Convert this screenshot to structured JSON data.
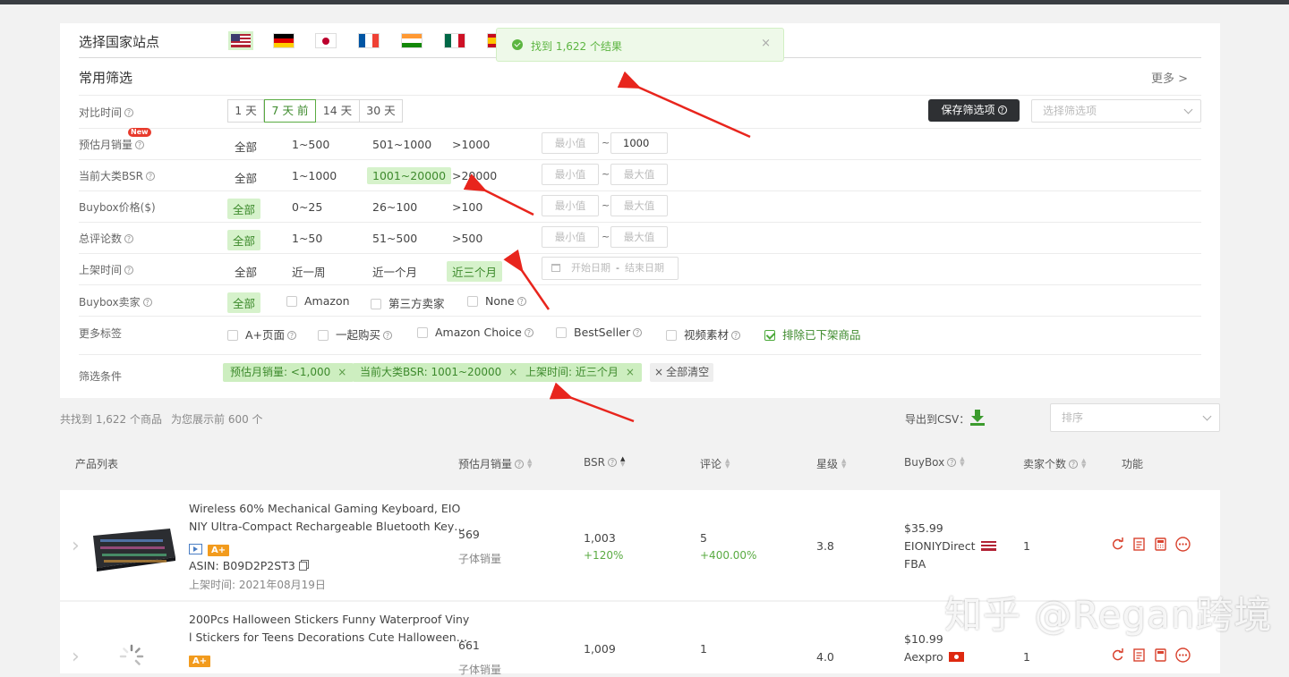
{
  "country": {
    "label": "选择国家站点",
    "flags": [
      "us-flag-icon",
      "de-flag-icon",
      "jp-flag-icon",
      "fr-flag-icon",
      "in-flag-icon",
      "mx-flag-icon",
      "es-flag-icon"
    ]
  },
  "toast": {
    "text": "找到 1,622 个结果",
    "close": "×"
  },
  "common_filter": {
    "title": "常用筛选",
    "more": "更多 >"
  },
  "compare_time": {
    "label": "对比时间",
    "options": [
      "1 天",
      "7 天 前",
      "14 天",
      "30 天"
    ],
    "selected": "7 天 前"
  },
  "save_button": "保存筛选项",
  "select_filter_placeholder": "选择筛选项",
  "rows": {
    "sales": {
      "label": "预估月销量",
      "badge": "New",
      "options": [
        "全部",
        "1~500",
        "501~1000",
        ">1000"
      ],
      "min": "最小值",
      "max": "1000"
    },
    "bsr": {
      "label": "当前大类BSR",
      "options": [
        "全部",
        "1~1000",
        "1001~20000",
        ">20000"
      ],
      "selected": "1001~20000",
      "min": "最小值",
      "max": "最大值"
    },
    "price": {
      "label": "Buybox价格($)",
      "options": [
        "全部",
        "0~25",
        "26~100",
        ">100"
      ],
      "selected": "全部",
      "min": "最小值",
      "max": "最大值"
    },
    "reviews": {
      "label": "总评论数",
      "options": [
        "全部",
        "1~50",
        "51~500",
        ">500"
      ],
      "selected": "全部",
      "min": "最小值",
      "max": "最大值"
    },
    "listed": {
      "label": "上架时间",
      "options": [
        "全部",
        "近一周",
        "近一个月",
        "近三个月"
      ],
      "selected": "近三个月",
      "start": "开始日期",
      "sep": "-",
      "end": "结束日期"
    },
    "seller": {
      "label": "Buybox卖家",
      "options": [
        "全部",
        "Amazon",
        "第三方卖家",
        "None"
      ],
      "selected": "全部"
    },
    "tags": {
      "label": "更多标签",
      "options": [
        "A+页面",
        "一起购买",
        "Amazon Choice",
        "BestSeller",
        "视频素材",
        "排除已下架商品"
      ],
      "checked": "排除已下架商品"
    }
  },
  "conditions": {
    "label": "筛选条件",
    "tags": [
      "预估月销量: <1,000",
      "当前大类BSR: 1001~20000",
      "上架时间: 近三个月"
    ],
    "clear": "全部清空"
  },
  "summary": {
    "found": "共找到 1,622 个商品",
    "showing": "为您展示前 600 个",
    "export": "导出到CSV：",
    "sort_placeholder": "排序"
  },
  "table": {
    "headers": [
      "产品列表",
      "预估月销量",
      "BSR",
      "评论",
      "星级",
      "BuyBox",
      "卖家个数",
      "功能"
    ],
    "products": [
      {
        "title1": "Wireless 60% Mechanical Gaming Keyboard, EIO",
        "title2": "NIY Ultra-Compact Rechargeable Bluetooth Key…",
        "aplus": "A+",
        "asin": "ASIN: B09D2P2ST3",
        "listed": "上架时间: 2021年08月19日",
        "sales": "569",
        "sales_sub": "子体销量",
        "bsr": "1,003",
        "bsr_change": "+120%",
        "reviews": "5",
        "reviews_change": "+400.00%",
        "rating": "3.8",
        "price": "$35.99",
        "seller": "EIONIYDirect",
        "fulfill": "FBA",
        "sellers": "1"
      },
      {
        "title1": "200Pcs Halloween Stickers Funny Waterproof Viny",
        "title2": "l Stickers for Teens Decorations Cute Halloween…",
        "aplus": "A+",
        "sales": "661",
        "sales_sub": "子体销量",
        "bsr": "1,009",
        "reviews": "1",
        "rating": "4.0",
        "price": "$10.99",
        "seller": "Aexpro",
        "sellers": "1"
      }
    ]
  },
  "watermark": "知乎 @Regan跨境",
  "colors": {
    "accent": "#5aab42",
    "highlight": "#d6f2cb",
    "arrow": "#e8251d",
    "dark_button": "#2e3033"
  }
}
